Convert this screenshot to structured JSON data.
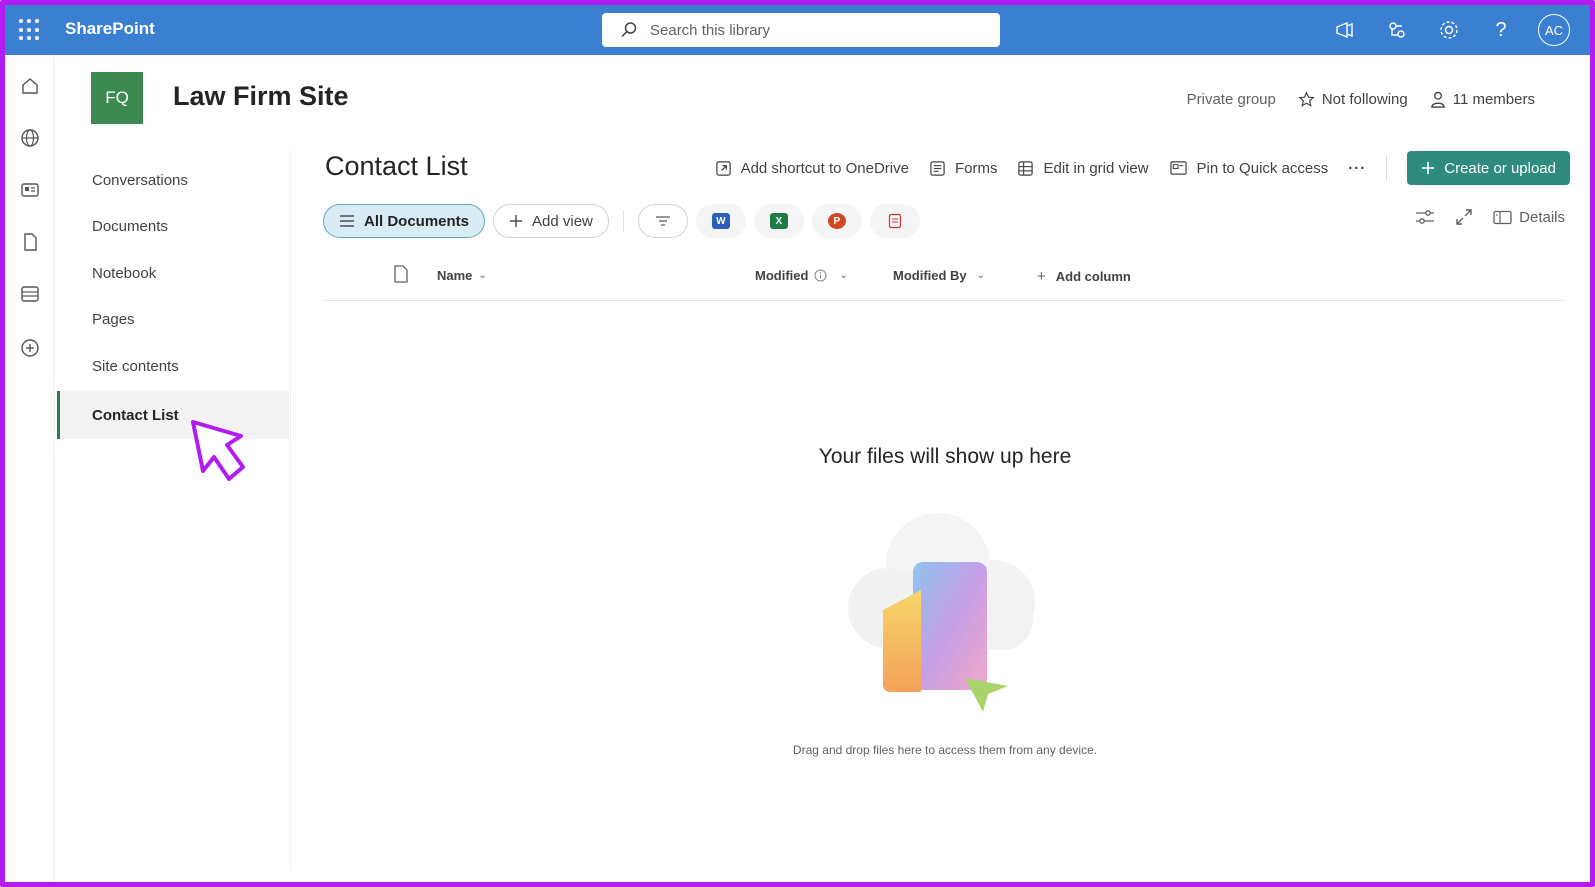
{
  "topbar": {
    "brand": "SharePoint",
    "search_placeholder": "Search this library",
    "avatar_initials": "AC"
  },
  "site": {
    "logo_initials": "FQ",
    "title": "Law Firm Site",
    "privacy": "Private group",
    "follow_label": "Not following",
    "members_label": "11 members"
  },
  "leftnav": {
    "items": [
      {
        "label": "Conversations"
      },
      {
        "label": "Documents"
      },
      {
        "label": "Notebook"
      },
      {
        "label": "Pages"
      },
      {
        "label": "Site contents"
      },
      {
        "label": "Contact List",
        "active": true
      }
    ]
  },
  "library": {
    "title": "Contact List",
    "commands": {
      "add_shortcut": "Add shortcut to OneDrive",
      "forms": "Forms",
      "edit_grid": "Edit in grid view",
      "pin_quick": "Pin to Quick access",
      "more": "···",
      "create_upload": "Create or upload"
    },
    "views": {
      "all_documents": "All Documents",
      "add_view": "Add view"
    },
    "details_label": "Details",
    "columns": {
      "name": "Name",
      "modified": "Modified",
      "modified_by": "Modified By",
      "add_column": "Add column"
    },
    "empty": {
      "title": "Your files will show up here",
      "subtitle": "Drag and drop files here to access them from any device."
    }
  },
  "colors": {
    "topbar": "#3a7fd0",
    "site_logo": "#3c8a52",
    "primary_button": "#2e8b7e",
    "annotation": "#b31cf0"
  }
}
